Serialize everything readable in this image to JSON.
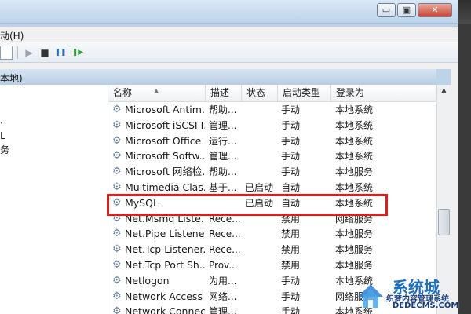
{
  "window": {
    "buttons": {
      "minimize": "▭",
      "maximize": "▣",
      "close": "✕"
    }
  },
  "menu": {
    "action": "动(H)"
  },
  "toolbar": {
    "play": "▶",
    "stop": "■",
    "pause": "❚❚",
    "resume": "❚▶"
  },
  "left_panel": {
    "header": "本地)",
    "text1": "·",
    "text2": "L",
    "text3": "务"
  },
  "columns": {
    "name": "名称",
    "desc": "描述",
    "status": "状态",
    "startup": "启动类型",
    "logon": "登录为"
  },
  "rows": [
    {
      "name": "Microsoft Antim...",
      "desc": "帮助...",
      "status": "",
      "startup": "手动",
      "logon": "本地系统"
    },
    {
      "name": "Microsoft iSCSI I...",
      "desc": "管理...",
      "status": "",
      "startup": "手动",
      "logon": "本地系统"
    },
    {
      "name": "Microsoft Office...",
      "desc": "运行...",
      "status": "",
      "startup": "手动",
      "logon": "本地系统"
    },
    {
      "name": "Microsoft Softw...",
      "desc": "管理...",
      "status": "",
      "startup": "手动",
      "logon": "本地系统"
    },
    {
      "name": "Microsoft 网络检...",
      "desc": "帮助...",
      "status": "",
      "startup": "手动",
      "logon": "本地服务"
    },
    {
      "name": "Multimedia Clas...",
      "desc": "基于...",
      "status": "已启动",
      "startup": "自动",
      "logon": "本地系统"
    },
    {
      "name": "MySQL",
      "desc": "",
      "status": "已启动",
      "startup": "自动",
      "logon": "本地系统"
    },
    {
      "name": "Net.Msmq Liste...",
      "desc": "Rece...",
      "status": "",
      "startup": "禁用",
      "logon": "网络服务"
    },
    {
      "name": "Net.Pipe Listene...",
      "desc": "Rece...",
      "status": "",
      "startup": "禁用",
      "logon": "本地服务"
    },
    {
      "name": "Net.Tcp Listener...",
      "desc": "Rece...",
      "status": "",
      "startup": "禁用",
      "logon": "本地服务"
    },
    {
      "name": "Net.Tcp Port Sh...",
      "desc": "Prov...",
      "status": "",
      "startup": "禁用",
      "logon": "本地服务"
    },
    {
      "name": "Netlogon",
      "desc": "为用...",
      "status": "",
      "startup": "手动",
      "logon": "本地系统"
    },
    {
      "name": "Network Access ...",
      "desc": "网络...",
      "status": "",
      "startup": "手动",
      "logon": "网络服务"
    },
    {
      "name": "Network Connec...",
      "desc": "管理...",
      "status": "",
      "startup": "手动",
      "logon": "本地系统"
    }
  ],
  "watermark": {
    "title": "系统城",
    "subtitle": "织梦内容管理系统",
    "url": "DEDECMS.COM",
    "url2": "xitongcheng.com"
  },
  "colors": {
    "highlight": "#e01c1c",
    "gear": "#6b7f99",
    "header_blue": "#b7cde3"
  }
}
